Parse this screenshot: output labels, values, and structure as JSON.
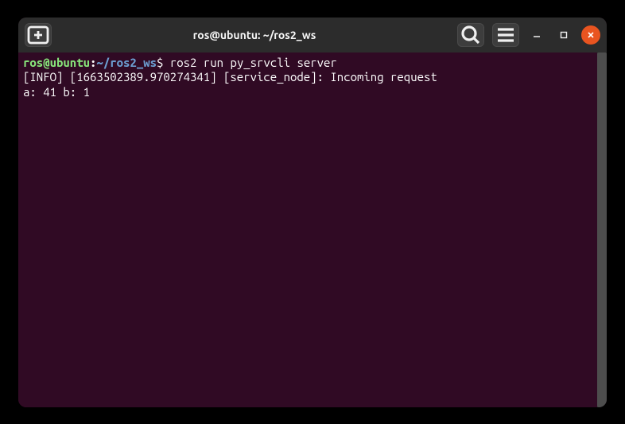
{
  "titlebar": {
    "title": "ros@ubuntu: ~/ros2_ws"
  },
  "prompt": {
    "user_host": "ros@ubuntu",
    "colon": ":",
    "path": "~/ros2_ws",
    "symbol": "$"
  },
  "command": "ros2 run py_srvcli server",
  "output": {
    "line1": "[INFO] [1663502389.970274341] [service_node]: Incoming request",
    "line2": "a: 41 b: 1"
  }
}
